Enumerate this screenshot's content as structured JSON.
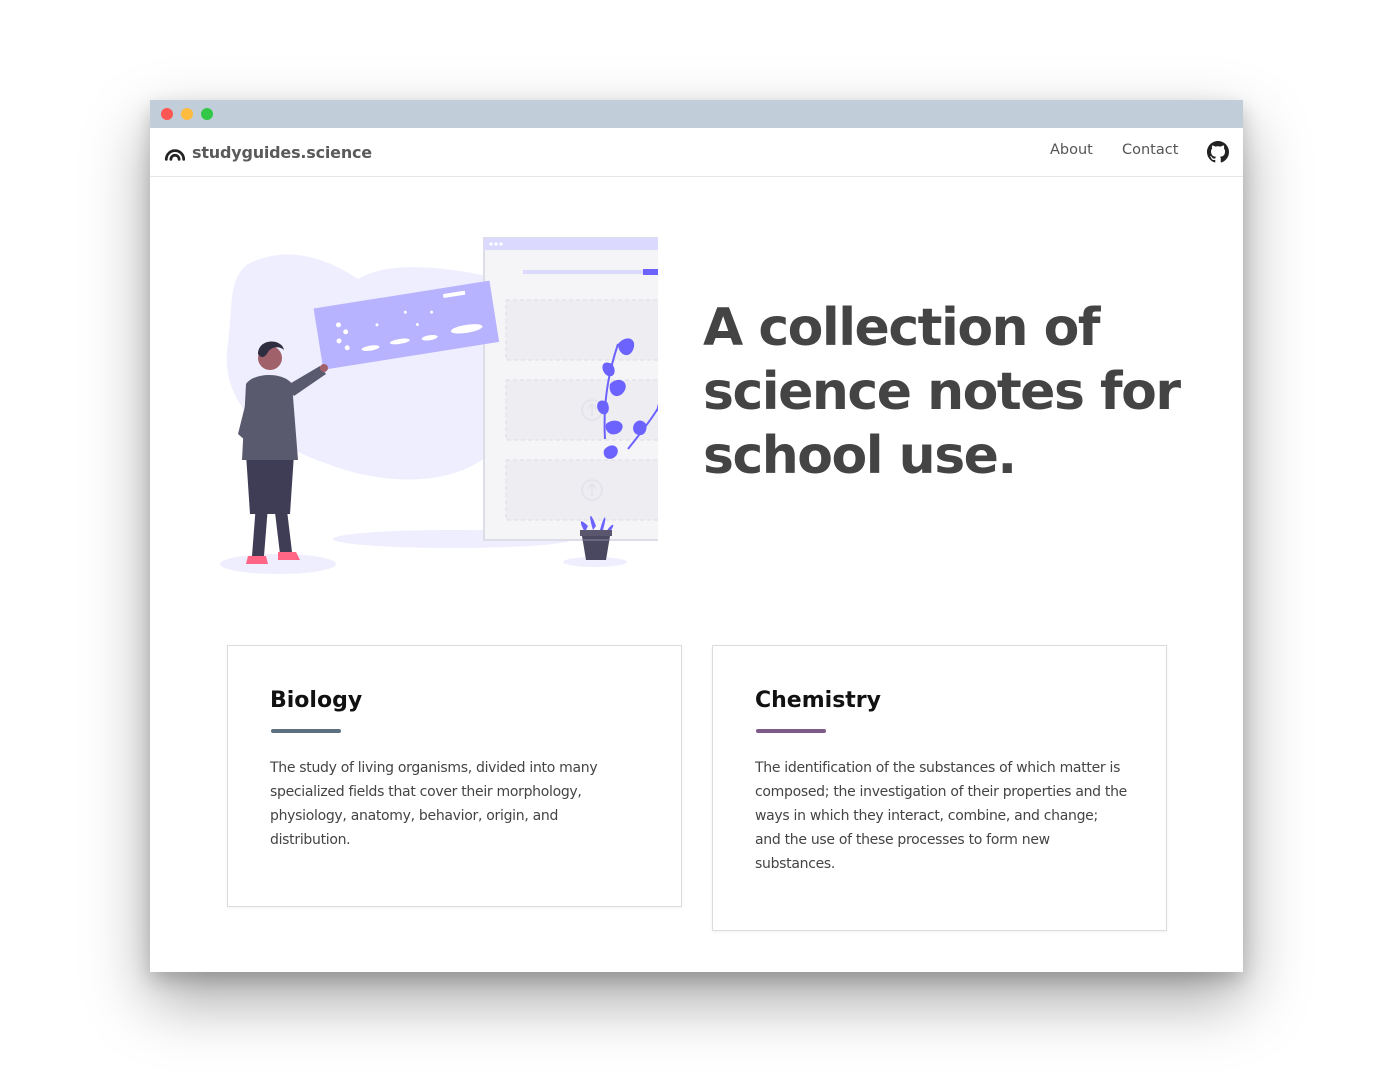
{
  "window": {
    "titlebar_color": "#c1ceda",
    "controls": [
      "close",
      "minimize",
      "maximize"
    ]
  },
  "navbar": {
    "brand": "studyguides.science",
    "brand_icon": "rainbow-arc-icon",
    "links": [
      {
        "label": "About"
      },
      {
        "label": "Contact"
      }
    ],
    "github_icon": "github-icon"
  },
  "hero": {
    "title": "A collection of science notes for school use.",
    "illustration": "person-uploading-content-illustration"
  },
  "cards": [
    {
      "title": "Biology",
      "accent": "#5d7080",
      "description": "The study of living organisms, divided into many specialized fields that cover their morphology, physiology, anatomy, behavior, origin, and distribution."
    },
    {
      "title": "Chemistry",
      "accent": "#7d5a8a",
      "description": "The identification of the substances of which matter is composed; the investigation of their properties and the ways in which they interact, combine, and change; and the use of these processes to form new substances."
    }
  ],
  "colors": {
    "illustration_primary": "#6c63ff",
    "illustration_light": "#b7b3ff",
    "illustration_bg": "#efeefe",
    "heading": "#444444"
  }
}
